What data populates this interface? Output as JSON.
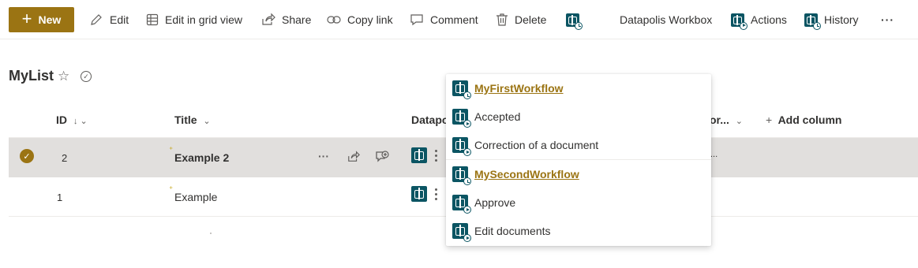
{
  "toolbar": {
    "new_label": "New",
    "edit_label": "Edit",
    "grid_label": "Edit in grid view",
    "share_label": "Share",
    "copy_link_label": "Copy link",
    "comment_label": "Comment",
    "delete_label": "Delete",
    "workbox_label": "Datapolis Workbox",
    "actions_label": "Actions",
    "history_label": "History",
    "more_label": "···"
  },
  "list": {
    "title": "MyList",
    "columns": {
      "id": "ID",
      "title": "Title",
      "datapolis": "Datapo",
      "truncated": "or...",
      "add_column": "Add column"
    },
    "rows": [
      {
        "id": "2",
        "title": "Example 2",
        "extra": "...",
        "selected": true
      },
      {
        "id": "1",
        "title": "Example",
        "selected": false
      }
    ]
  },
  "menu": {
    "items": [
      {
        "label": "MyFirstWorkflow",
        "kind": "workflow"
      },
      {
        "label": "Accepted",
        "kind": "action"
      },
      {
        "label": "Correction of a document",
        "kind": "action"
      },
      {
        "label": "MySecondWorkflow",
        "kind": "workflow"
      },
      {
        "label": "Approve",
        "kind": "action"
      },
      {
        "label": "Edit documents",
        "kind": "action"
      }
    ]
  },
  "colors": {
    "accent": "#9b7413",
    "datapolis_teal": "#0b5563",
    "selected_row": "#e1dfdd"
  }
}
